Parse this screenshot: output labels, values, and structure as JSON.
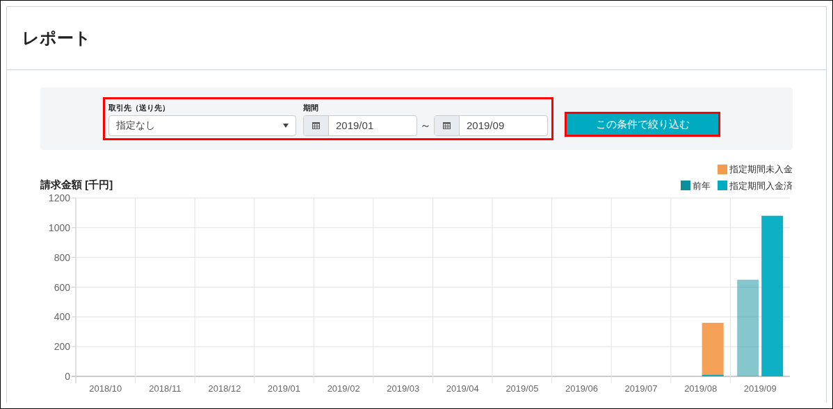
{
  "page": {
    "title": "レポート"
  },
  "filters": {
    "client": {
      "label": "取引先（送り先）",
      "value": "指定なし"
    },
    "period": {
      "label": "期間",
      "from": "2019/01",
      "separator": "～",
      "to": "2019/09"
    },
    "submit": "この条件で絞り込む"
  },
  "chart_data": {
    "type": "bar",
    "title": "請求金額 [千円]",
    "categories": [
      "2018/10",
      "2018/11",
      "2018/12",
      "2019/01",
      "2019/02",
      "2019/03",
      "2019/04",
      "2019/05",
      "2019/06",
      "2019/07",
      "2019/08",
      "2019/09"
    ],
    "ylim": [
      0,
      1200
    ],
    "yticks": [
      0,
      200,
      400,
      600,
      800,
      1000,
      1200
    ],
    "grid": true,
    "series": [
      {
        "name": "前年",
        "color": "#0d8e9b",
        "values": [
          0,
          0,
          0,
          0,
          0,
          0,
          0,
          0,
          0,
          0,
          0,
          650
        ]
      },
      {
        "name": "指定期間入金済",
        "color": "#00acc1",
        "values": [
          0,
          0,
          0,
          0,
          0,
          0,
          0,
          0,
          0,
          0,
          10,
          1080
        ]
      },
      {
        "name": "指定期間未入金",
        "color": "#f39b4e",
        "values": [
          0,
          0,
          0,
          0,
          0,
          0,
          0,
          0,
          0,
          0,
          360,
          0
        ]
      }
    ]
  }
}
